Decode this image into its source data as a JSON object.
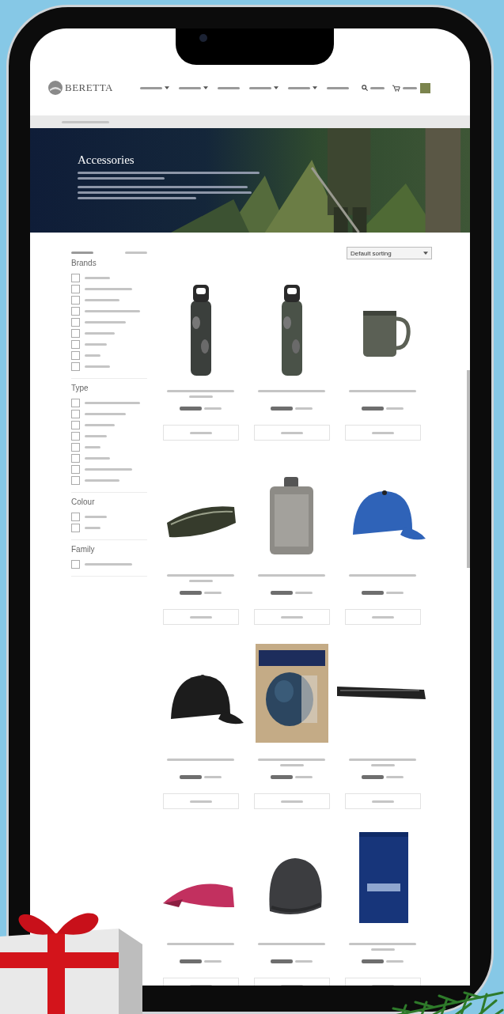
{
  "header": {
    "logo": "BERETTA",
    "nav": [
      {
        "dropdown": true
      },
      {
        "dropdown": true
      },
      {
        "dropdown": false
      },
      {
        "dropdown": true
      },
      {
        "dropdown": true
      },
      {
        "dropdown": false
      }
    ]
  },
  "hero": {
    "title": "Accessories",
    "kind": "picture"
  },
  "sort": {
    "value": "Default sorting"
  },
  "filters": [
    {
      "title": "Brands",
      "options": [
        {
          "checked": false
        },
        {
          "checked": false
        },
        {
          "checked": false
        },
        {
          "checked": false
        },
        {
          "checked": false
        },
        {
          "checked": false
        },
        {
          "checked": false
        },
        {
          "checked": false
        },
        {
          "checked": false
        }
      ]
    },
    {
      "title": "Type",
      "options": [
        {
          "checked": false
        },
        {
          "checked": false
        },
        {
          "checked": false
        },
        {
          "checked": false
        },
        {
          "checked": false
        },
        {
          "checked": false
        },
        {
          "checked": false
        },
        {
          "checked": false
        }
      ]
    },
    {
      "title": "Colour",
      "options": [
        {
          "checked": false
        },
        {
          "checked": false
        }
      ]
    },
    {
      "title": "Family",
      "options": [
        {
          "checked": false
        }
      ]
    }
  ],
  "products": [
    {
      "kind": "bottle",
      "color": "#3b3f3c",
      "long_title": true
    },
    {
      "kind": "bottle",
      "color": "#4a5248",
      "long_title": false
    },
    {
      "kind": "mug",
      "color": "#5b6055",
      "long_title": false
    },
    {
      "kind": "waist-bag",
      "color": "#363b2c",
      "long_title": true
    },
    {
      "kind": "flask",
      "color": "#8d8b86",
      "long_title": false
    },
    {
      "kind": "cap",
      "color": "#2f63b8",
      "long_title": false
    },
    {
      "kind": "cap",
      "color": "#1c1c1c",
      "long_title": false
    },
    {
      "kind": "package",
      "color": "#2c4660",
      "long_title": true
    },
    {
      "kind": "rifle-case",
      "color": "#222222",
      "long_title": true
    },
    {
      "kind": "visor",
      "color": "#c2305f",
      "long_title": false
    },
    {
      "kind": "beanie",
      "color": "#3c3d40",
      "long_title": false
    },
    {
      "kind": "towel",
      "color": "#17357a",
      "long_title": true
    }
  ]
}
